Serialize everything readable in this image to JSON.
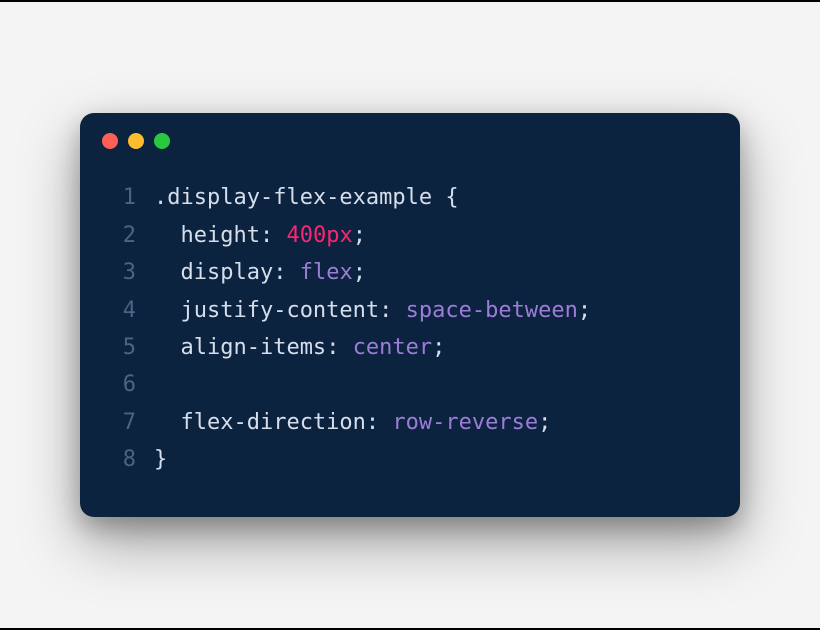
{
  "window": {
    "dots": [
      "red",
      "yellow",
      "green"
    ]
  },
  "code": {
    "lines": [
      {
        "n": "1",
        "indent": 0,
        "tokens": [
          {
            "t": ".display-flex-example ",
            "c": "selector"
          },
          {
            "t": "{",
            "c": "punct"
          }
        ]
      },
      {
        "n": "2",
        "indent": 1,
        "tokens": [
          {
            "t": "height",
            "c": "prop"
          },
          {
            "t": ": ",
            "c": "punct"
          },
          {
            "t": "400px",
            "c": "number"
          },
          {
            "t": ";",
            "c": "punct"
          }
        ]
      },
      {
        "n": "3",
        "indent": 1,
        "tokens": [
          {
            "t": "display",
            "c": "prop"
          },
          {
            "t": ": ",
            "c": "punct"
          },
          {
            "t": "flex",
            "c": "value"
          },
          {
            "t": ";",
            "c": "punct"
          }
        ]
      },
      {
        "n": "4",
        "indent": 1,
        "tokens": [
          {
            "t": "justify-content",
            "c": "prop"
          },
          {
            "t": ": ",
            "c": "punct"
          },
          {
            "t": "space-between",
            "c": "value"
          },
          {
            "t": ";",
            "c": "punct"
          }
        ]
      },
      {
        "n": "5",
        "indent": 1,
        "tokens": [
          {
            "t": "align-items",
            "c": "prop"
          },
          {
            "t": ": ",
            "c": "punct"
          },
          {
            "t": "center",
            "c": "value"
          },
          {
            "t": ";",
            "c": "punct"
          }
        ]
      },
      {
        "n": "6",
        "indent": 0,
        "tokens": []
      },
      {
        "n": "7",
        "indent": 1,
        "tokens": [
          {
            "t": "flex-direction",
            "c": "prop"
          },
          {
            "t": ": ",
            "c": "punct"
          },
          {
            "t": "row-reverse",
            "c": "value"
          },
          {
            "t": ";",
            "c": "punct"
          }
        ]
      },
      {
        "n": "8",
        "indent": 0,
        "tokens": [
          {
            "t": "}",
            "c": "punct"
          }
        ]
      }
    ]
  }
}
